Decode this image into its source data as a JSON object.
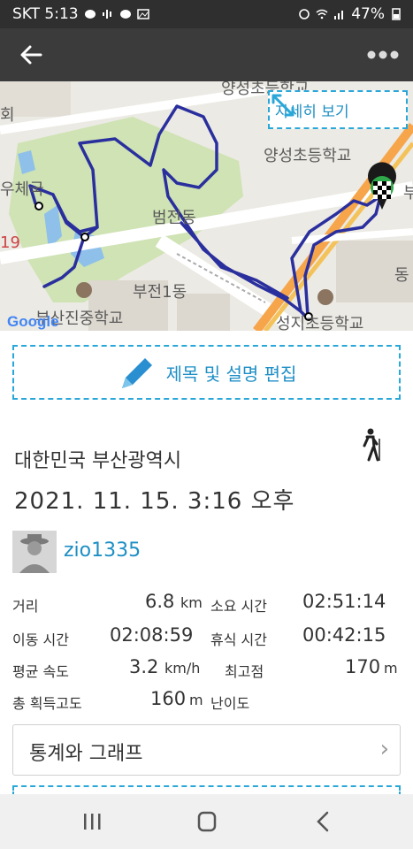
{
  "status_bar": {
    "carrier_time": "SKT 5:13",
    "battery": "47%"
  },
  "app_bar": {
    "back_icon": "arrow-left-icon",
    "more_icon": "more-horizontal-icon"
  },
  "map": {
    "labels": {
      "yangseong_school": "양성초등학교",
      "beomjeon": "범전동",
      "bujeon1": "부전1동",
      "busan_jin_middle": "부산진중학교",
      "seongji_school": "성지초등학교",
      "post_office": "우체국",
      "hoe": "회",
      "num19": "19",
      "dong": "동",
      "bu": "부",
      "top_cut": "양성초등학교"
    },
    "detail_button_label": "자세히 보기",
    "attribution": "Google",
    "route_color": "#2a2f9e"
  },
  "edit_button_label": "제목 및 설명 편집",
  "activity": {
    "location": "대한민국 부산광역시",
    "datetime": "2021. 11. 15. 3:16 오후",
    "username": "zio1335"
  },
  "stats": {
    "distance_label": "거리",
    "distance_value": "6.8",
    "distance_unit": "km",
    "duration_label": "소요 시간",
    "duration_value": "02:51:14",
    "moving_label": "이동 시간",
    "moving_value": "02:08:59",
    "rest_label": "휴식 시간",
    "rest_value": "00:42:15",
    "speed_label": "평균 속도",
    "speed_value": "3.2",
    "speed_unit": "km/h",
    "max_alt_label": "최고점",
    "max_alt_value": "170",
    "max_alt_unit": "m",
    "gain_label": "총 획득고도",
    "gain_value": "160",
    "gain_unit": "m",
    "difficulty_label": "난이도"
  },
  "graph_button_label": "통계와 그래프",
  "graph_chevron": "›",
  "nav": {
    "recent": "recent-apps-icon",
    "home": "home-icon",
    "back": "back-icon"
  }
}
